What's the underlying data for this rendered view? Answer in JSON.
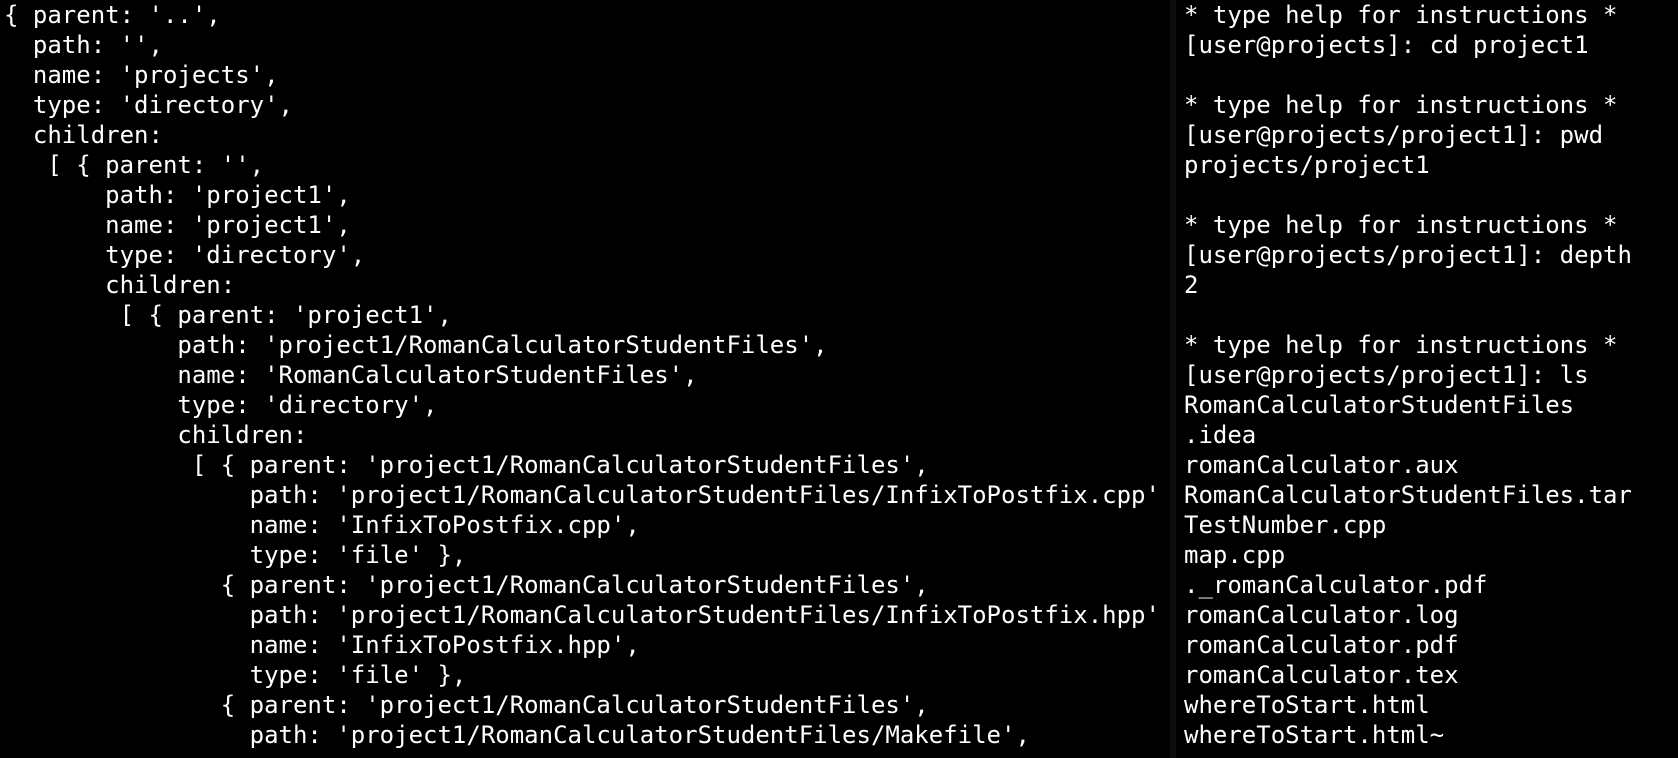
{
  "left_pane": {
    "lines": [
      "{ parent: '..',",
      "  path: '',",
      "  name: 'projects',",
      "  type: 'directory',",
      "  children:",
      "   [ { parent: '',",
      "       path: 'project1',",
      "       name: 'project1',",
      "       type: 'directory',",
      "       children:",
      "        [ { parent: 'project1',",
      "            path: 'project1/RomanCalculatorStudentFiles',",
      "            name: 'RomanCalculatorStudentFiles',",
      "            type: 'directory',",
      "            children:",
      "             [ { parent: 'project1/RomanCalculatorStudentFiles',",
      "                 path: 'project1/RomanCalculatorStudentFiles/InfixToPostfix.cpp',",
      "                 name: 'InfixToPostfix.cpp',",
      "                 type: 'file' },",
      "               { parent: 'project1/RomanCalculatorStudentFiles',",
      "                 path: 'project1/RomanCalculatorStudentFiles/InfixToPostfix.hpp',",
      "                 name: 'InfixToPostfix.hpp',",
      "                 type: 'file' },",
      "               { parent: 'project1/RomanCalculatorStudentFiles',",
      "                 path: 'project1/RomanCalculatorStudentFiles/Makefile',"
    ]
  },
  "right_pane": {
    "lines": [
      "* type help for instructions *",
      "[user@projects]: cd project1",
      "",
      "* type help for instructions *",
      "[user@projects/project1]: pwd",
      "projects/project1",
      "",
      "* type help for instructions *",
      "[user@projects/project1]: depth",
      "2",
      "",
      "* type help for instructions *",
      "[user@projects/project1]: ls",
      "RomanCalculatorStudentFiles",
      ".idea",
      "romanCalculator.aux",
      "RomanCalculatorStudentFiles.tar",
      "TestNumber.cpp",
      "map.cpp",
      "._romanCalculator.pdf",
      "romanCalculator.log",
      "romanCalculator.pdf",
      "romanCalculator.tex",
      "whereToStart.html",
      "whereToStart.html~"
    ]
  }
}
